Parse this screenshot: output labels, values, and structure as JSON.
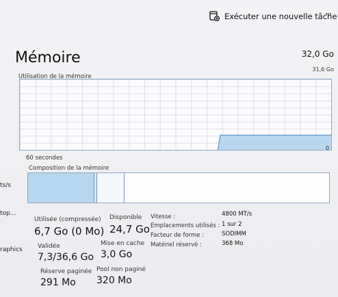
{
  "header": {
    "run_task_label": "Exécuter une nouvelle tâche",
    "more_glyph": "··"
  },
  "side": {
    "label_1": "ts/s",
    "label_2": "top...",
    "label_3": "raphics"
  },
  "memory": {
    "title": "Mémoire",
    "total": "32,0 Go",
    "usage_label": "Utilisation de la mémoire",
    "usage_max": "31,6 Go",
    "seconds_label": "60 secondes",
    "zero_label": "0",
    "composition_label": "Composition de la mémoire",
    "usage_history_fraction": [
      0,
      0,
      0,
      0,
      0,
      0,
      0,
      0,
      0,
      0,
      0,
      0,
      0,
      0,
      0,
      0,
      0,
      0,
      0,
      0,
      0,
      0,
      0,
      0,
      0,
      0,
      0,
      0,
      0,
      0,
      0,
      0,
      0,
      0,
      0,
      0,
      0,
      0,
      0.21,
      0.21,
      0.21,
      0.21,
      0.21,
      0.21,
      0.21,
      0.21,
      0.21,
      0.21,
      0.21,
      0.21,
      0.21,
      0.21,
      0.21,
      0.21,
      0.21,
      0.21,
      0.21,
      0.21,
      0.21,
      0.21
    ],
    "composition_fraction": {
      "used": 0.22,
      "modified": 0.01,
      "standby": 0.09
    },
    "colors": {
      "graph_fill": "#b8d6ee",
      "graph_line": "#4f86bd",
      "border": "#8ea9c6"
    }
  },
  "stats": {
    "used_label": "Utilisée (compressée)",
    "used_value": "6,7 Go (0 Mo)",
    "available_label": "Disponible",
    "available_value": "24,7 Go",
    "committed_label": "Validée",
    "committed_value": "7,3/36,6 Go",
    "cached_label": "Mise en cache",
    "cached_value": "3,0 Go",
    "paged_label": "Réserve paginée",
    "paged_value": "291 Mo",
    "nonpaged_label": "Pool non paginé",
    "nonpaged_value": "320 Mo"
  },
  "specs": {
    "speed_label": "Vitesse :",
    "speed_value": "4800 MT/s",
    "slots_label": "Emplacements utilisés :",
    "slots_value": "1 sur 2",
    "form_label": "Facteur de forme :",
    "form_value": "SODIMM",
    "reserved_label": "Matériel réservé :",
    "reserved_value": "368 Mo"
  }
}
